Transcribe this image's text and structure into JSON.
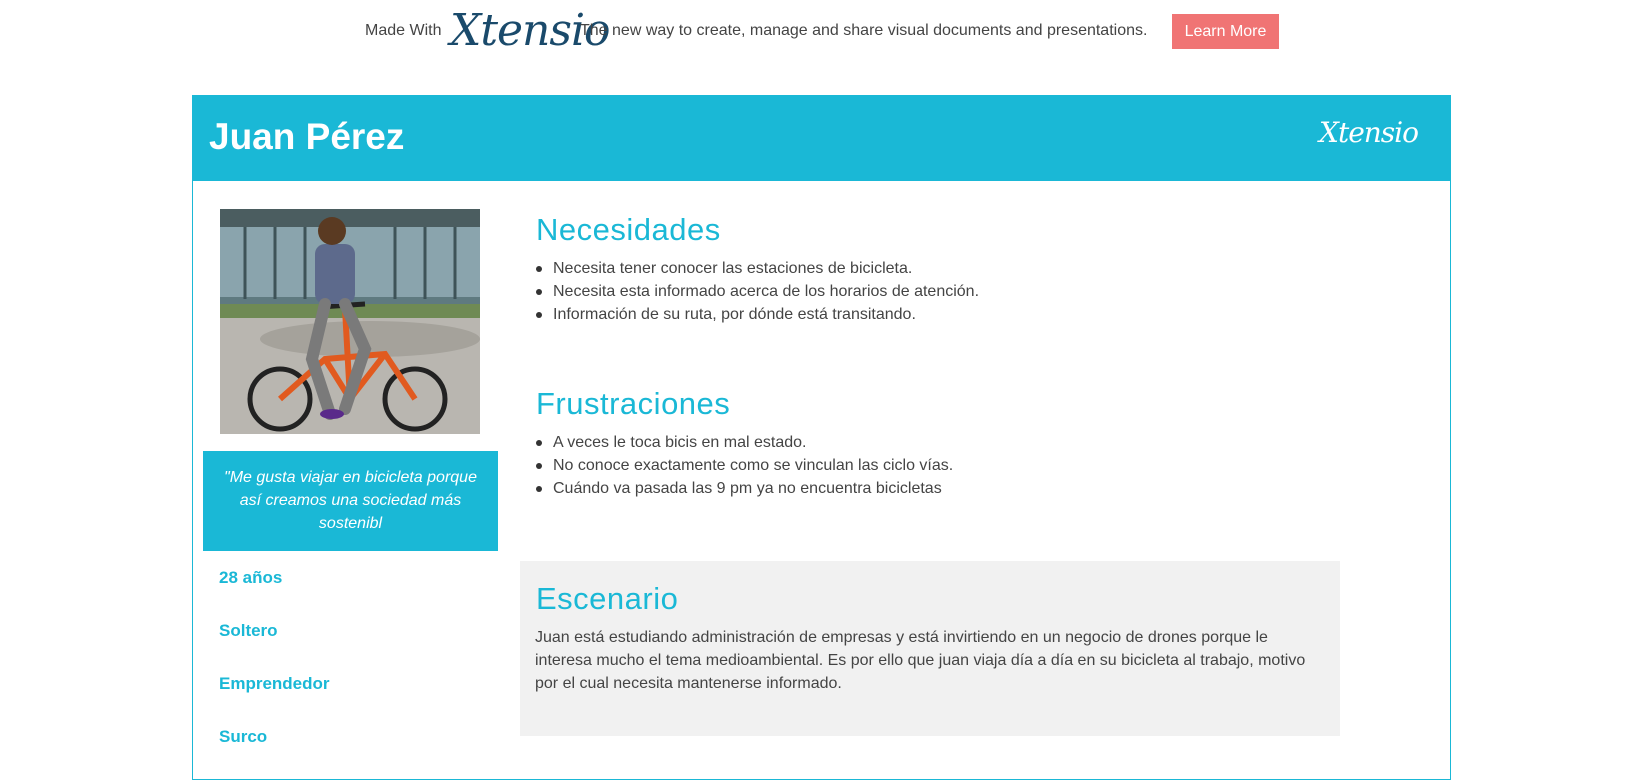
{
  "promo": {
    "made_with": "Made With",
    "logo": "Xtensio",
    "tagline": "The new way to create, manage and share visual documents and presentations.",
    "button": "Learn More"
  },
  "persona": {
    "name": "Juan Pérez",
    "header_logo": "Xtensio",
    "quote": "\"Me gusta viajar en bicicleta porque así creamos una sociedad más sostenibl",
    "attributes": [
      "28 años",
      "Soltero",
      "Emprendedor",
      "Surco"
    ]
  },
  "needs": {
    "title": "Necesidades",
    "items": [
      "Necesita tener conocer las estaciones de bicicleta.",
      "Necesita esta informado acerca de los horarios de atención.",
      "Información de su ruta, por dónde está transitando."
    ]
  },
  "frustrations": {
    "title": "Frustraciones",
    "items": [
      "A veces le toca bicis en mal estado.",
      "No conoce exactamente como se vinculan las ciclo vías.",
      "Cuándo va pasada las 9 pm ya no encuentra bicicletas"
    ]
  },
  "scenario": {
    "title": "Escenario",
    "text": "Juan está estudiando administración de empresas y está invirtiendo en un negocio de drones porque le interesa mucho el tema medioambiental. Es por ello que juan viaja día a día en su bicicleta al trabajo, motivo por el cual necesita mantenerse informado."
  },
  "colors": {
    "accent": "#1ab8d6",
    "button": "#f07474",
    "scenario_bg": "#f1f1f1"
  }
}
